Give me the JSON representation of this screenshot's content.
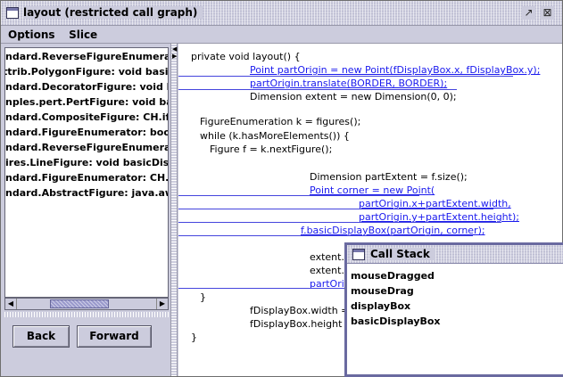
{
  "window": {
    "title": "layout (restricted call graph)",
    "maximize_glyph": "↗",
    "close_glyph": "⊠"
  },
  "menu": [
    "Options",
    "Slice"
  ],
  "method_list": [
    "ndard.ReverseFigureEnumerator:",
    "ttrib.PolygonFigure: void basicDis|",
    "ndard.DecoratorFigure: void basic",
    "nples.pert.PertFigure: void basicD",
    "ndard.CompositeFigure: CH.ifa.dr:",
    "ndard.FigureEnumerator: boolean",
    "ndard.ReverseFigureEnumerator:",
    "ires.LineFigure: void basicDisplay",
    "ndard.FigureEnumerator: CH.ifa.d",
    "ndard.AbstractFigure: java.awt.Di"
  ],
  "buttons": {
    "back": "Back",
    "forward": "Forward"
  },
  "code_lines": [
    {
      "text": "private void layout() {",
      "hl": false
    },
    {
      "text": "Point partOrigin = new Point(fDisplayBox.x, fDisplayBox.y);",
      "hl": true
    },
    {
      "text": "partOrigin.translate(BORDER, BORDER);",
      "hl": true
    },
    {
      "text": "Dimension extent = new Dimension(0, 0);",
      "hl": false
    },
    {
      "text": "FigureEnumeration k = figures();",
      "hl": false
    },
    {
      "text": "while (k.hasMoreElements()) {",
      "hl": false
    },
    {
      "text": "Figure f = k.nextFigure();",
      "hl": false
    },
    {
      "text": "Dimension partExtent = f.size();",
      "hl": false
    },
    {
      "text": "Point corner = new Point(",
      "hl": true
    },
    {
      "text": "partOrigin.x+partExtent.width,",
      "hl": true
    },
    {
      "text": "partOrigin.y+partExtent.height);",
      "hl": true
    },
    {
      "text": "f.basicDisplayBox(partOrigin, corner);",
      "hl": true
    },
    {
      "text": "extent.w",
      "hl": false
    },
    {
      "text": "extent.h",
      "hl": false
    },
    {
      "text": "partOric",
      "hl": true
    },
    {
      "text": "}",
      "hl": false
    },
    {
      "text": "fDisplayBox.width = e",
      "hl": false
    },
    {
      "text": "fDisplayBox.height =",
      "hl": false
    },
    {
      "text": "}",
      "hl": false
    }
  ],
  "call_stack": {
    "title": "Call Stack",
    "items": [
      "mouseDragged",
      "mouseDrag",
      "displayBox",
      "basicDisplayBox"
    ]
  },
  "colors": {
    "chrome": "#ccccdd",
    "highlight_text": "#1a1aee",
    "highlight_line": "#4444dd",
    "frame": "#6a6aa0"
  }
}
